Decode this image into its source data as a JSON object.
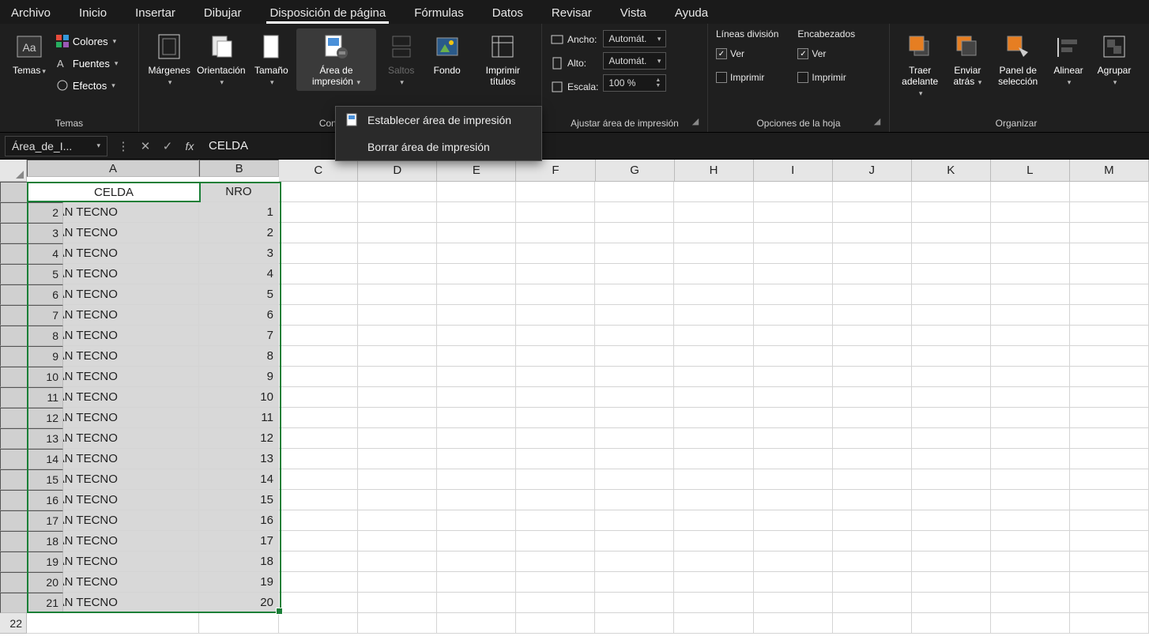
{
  "tabs": [
    "Archivo",
    "Inicio",
    "Insertar",
    "Dibujar",
    "Disposición de página",
    "Fórmulas",
    "Datos",
    "Revisar",
    "Vista",
    "Ayuda"
  ],
  "active_tab_index": 4,
  "ribbon": {
    "themes": {
      "label": "Temas",
      "btn": "Temas",
      "colors": "Colores",
      "fonts": "Fuentes",
      "effects": "Efectos"
    },
    "pageSetup": {
      "label": "Configu…",
      "margins": "Márgenes",
      "orientation": "Orientación",
      "size": "Tamaño",
      "printArea": "Área de impresión",
      "breaks": "Saltos",
      "background": "Fondo",
      "printTitles": "Imprimir títulos"
    },
    "scaleToFit": {
      "label": "Ajustar área de impresión",
      "width": "Ancho:",
      "height": "Alto:",
      "scale": "Escala:",
      "auto": "Automát.",
      "scaleVal": "100 %"
    },
    "sheetOptions": {
      "label": "Opciones de la hoja",
      "gridlines": "Líneas división",
      "headings": "Encabezados",
      "view": "Ver",
      "print": "Imprimir"
    },
    "arrange": {
      "label": "Organizar",
      "bringForward": "Traer adelante",
      "sendBackward": "Enviar atrás",
      "selectionPane": "Panel de selección",
      "align": "Alinear",
      "group": "Agrupar"
    }
  },
  "dropdown": {
    "set": "Establecer área de impresión",
    "clear": "Borrar área de impresión"
  },
  "formulaBar": {
    "name": "Área_de_I...",
    "value": "CELDA"
  },
  "columns": [
    "A",
    "B",
    "C",
    "D",
    "E",
    "F",
    "G",
    "H",
    "I",
    "J",
    "K",
    "L",
    "M"
  ],
  "headers": {
    "A": "CELDA",
    "B": "NRO"
  },
  "data_text": "URBAN TECNO",
  "row_count": 22
}
